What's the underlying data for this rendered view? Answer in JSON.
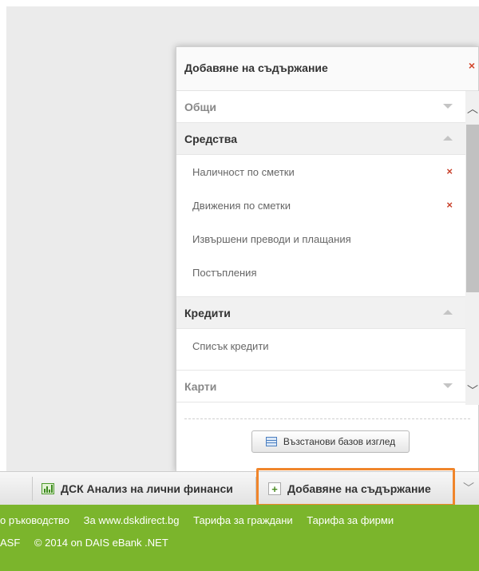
{
  "popup": {
    "title": "Добавяне на съдържание",
    "close_label": "×",
    "sections": [
      {
        "label": "Общи",
        "state": "collapsed",
        "items": []
      },
      {
        "label": "Средства",
        "state": "expanded",
        "items": [
          {
            "label": "Наличност по сметки",
            "added": true
          },
          {
            "label": "Движения по сметки",
            "added": true
          },
          {
            "label": "Извършени преводи и плащания",
            "added": false
          },
          {
            "label": "Постъпления",
            "added": false
          }
        ]
      },
      {
        "label": "Кредити",
        "state": "expanded",
        "items": [
          {
            "label": "Списък кредити",
            "added": false
          }
        ]
      },
      {
        "label": "Карти",
        "state": "collapsed",
        "items": []
      }
    ],
    "remove_label": "×",
    "reset_button": "Възстанови базов изглед"
  },
  "taskbar": {
    "analysis_label": "ДСК Анализ на лични финанси",
    "add_content_label": "Добавяне на съдържание",
    "dropdown_icon": "chevron-down-icon",
    "highlight_color": "#f0852b"
  },
  "footer": {
    "row1": [
      "о ръководство",
      "За www.dskdirect.bg",
      "Тарифа за граждани",
      "Тарифа за фирми"
    ],
    "row2": [
      "ASF",
      "© 2014 on DAIS eBank .NET"
    ],
    "bg_color": "#7bb52c"
  }
}
